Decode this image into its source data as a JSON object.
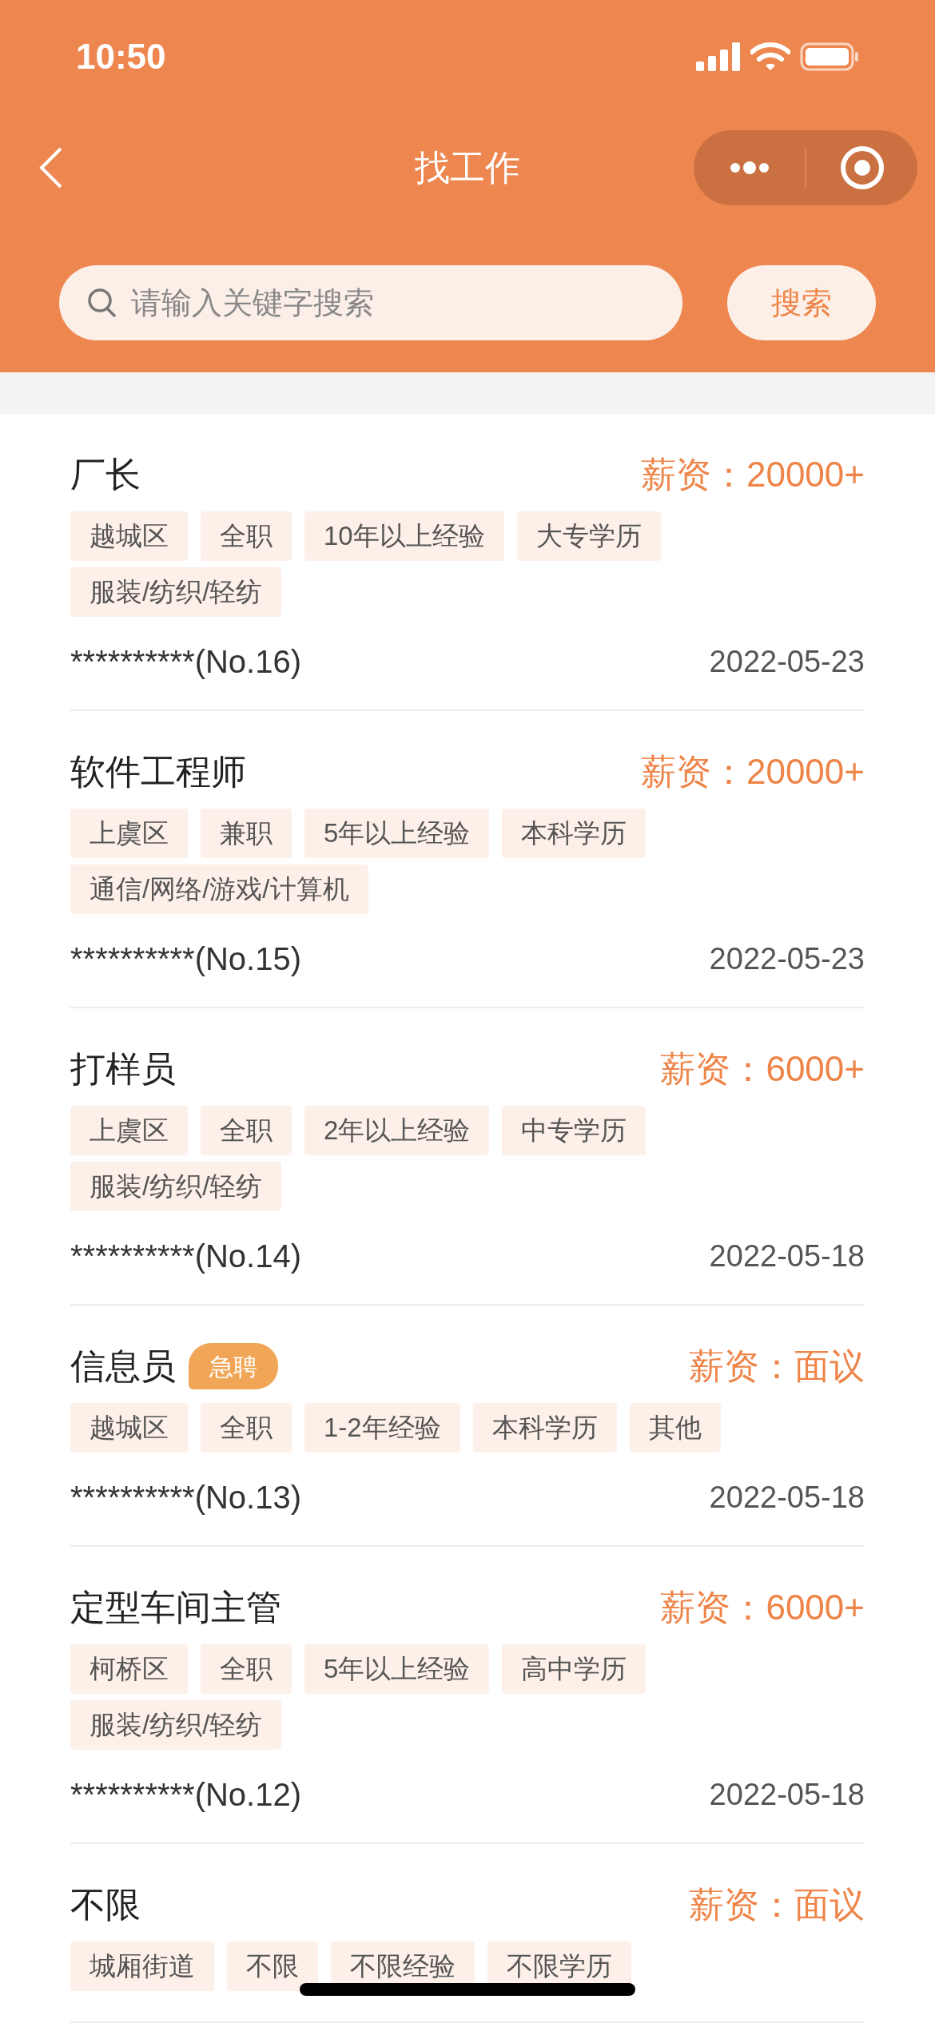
{
  "status_bar": {
    "time": "10:50"
  },
  "nav": {
    "title": "找工作"
  },
  "search": {
    "placeholder": "请输入关键字搜索",
    "button": "搜索"
  },
  "jobs": [
    {
      "title": "厂长",
      "urgent": false,
      "salary": "薪资：20000+",
      "tags": [
        "越城区",
        "全职",
        "10年以上经验",
        "大专学历",
        "服装/纺织/轻纺"
      ],
      "company": "**********(No.16)",
      "date": "2022-05-23"
    },
    {
      "title": "软件工程师",
      "urgent": false,
      "salary": "薪资：20000+",
      "tags": [
        "上虞区",
        "兼职",
        "5年以上经验",
        "本科学历",
        "通信/网络/游戏/计算机"
      ],
      "company": "**********(No.15)",
      "date": "2022-05-23"
    },
    {
      "title": "打样员",
      "urgent": false,
      "salary": "薪资：6000+",
      "tags": [
        "上虞区",
        "全职",
        "2年以上经验",
        "中专学历",
        "服装/纺织/轻纺"
      ],
      "company": "**********(No.14)",
      "date": "2022-05-18"
    },
    {
      "title": "信息员",
      "urgent": true,
      "badge": "急聘",
      "salary": "薪资：面议",
      "tags": [
        "越城区",
        "全职",
        "1-2年经验",
        "本科学历",
        "其他"
      ],
      "company": "**********(No.13)",
      "date": "2022-05-18"
    },
    {
      "title": "定型车间主管",
      "urgent": false,
      "salary": "薪资：6000+",
      "tags": [
        "柯桥区",
        "全职",
        "5年以上经验",
        "高中学历",
        "服装/纺织/轻纺"
      ],
      "company": "**********(No.12)",
      "date": "2022-05-18"
    },
    {
      "title": "不限",
      "urgent": false,
      "salary": "薪资：面议",
      "tags": [
        "城厢街道",
        "不限",
        "不限经验",
        "不限学历"
      ]
    }
  ]
}
